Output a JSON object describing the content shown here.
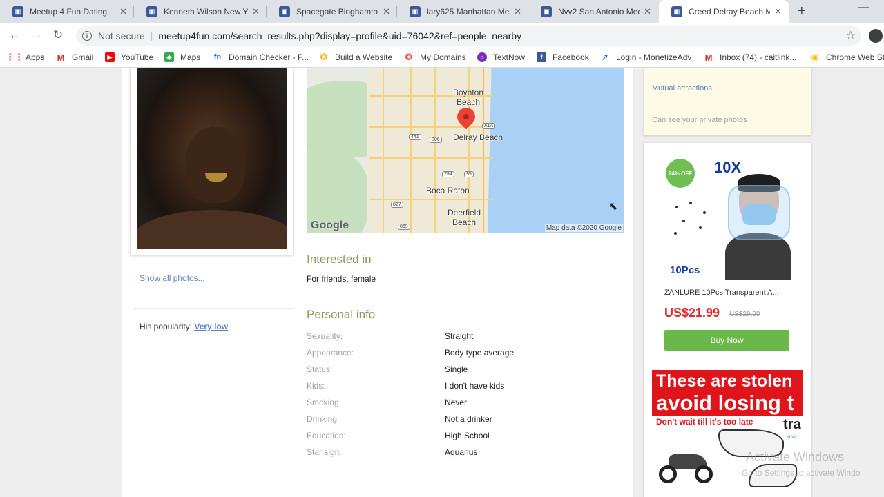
{
  "browser": {
    "tabs": [
      {
        "title": "Meetup 4 Fun Dating",
        "active": false
      },
      {
        "title": "Kenneth Wilson New Y",
        "active": false
      },
      {
        "title": "Spacegate Binghamton",
        "active": false
      },
      {
        "title": "lary625 Manhattan Me",
        "active": false
      },
      {
        "title": "Nvv2 San Antonio Mee",
        "active": false
      },
      {
        "title": "Creed Delray Beach Me",
        "active": true
      }
    ],
    "security_label": "Not secure",
    "url": "meetup4fun.com/search_results.php?display=profile&uid=76042&ref=people_nearby",
    "bookmarks": [
      {
        "label": "Apps",
        "icon": "apps-grid-icon",
        "color": "#e94235"
      },
      {
        "label": "Gmail",
        "icon": "gmail-icon",
        "color": "#d93025"
      },
      {
        "label": "YouTube",
        "icon": "youtube-icon",
        "color": "#ff0000"
      },
      {
        "label": "Maps",
        "icon": "maps-icon",
        "color": "#34a853"
      },
      {
        "label": "Domain Checker - F...",
        "icon": "domain-icon",
        "color": "#1a73e8"
      },
      {
        "label": "Build a Website",
        "icon": "build-icon",
        "color": "#f9ab00"
      },
      {
        "label": "My Domains",
        "icon": "domains-icon",
        "color": "#ea4335"
      },
      {
        "label": "TextNow",
        "icon": "textnow-icon",
        "color": "#7b2cbf"
      },
      {
        "label": "Facebook",
        "icon": "facebook-icon",
        "color": "#3b5998"
      },
      {
        "label": "Login - MonetizeAdv",
        "icon": "login-icon",
        "color": "#1565c0"
      },
      {
        "label": "Inbox (74) - caitlink...",
        "icon": "inbox-icon",
        "color": "#d93025"
      },
      {
        "label": "Chrome Web St",
        "icon": "chrome-icon",
        "color": "#fbbc04"
      }
    ]
  },
  "profile": {
    "show_all_photos": "Show all photos...",
    "popularity_label": "His popularity:",
    "popularity_value": "Very low"
  },
  "map": {
    "labels": {
      "boynton": "Boynton\nBeach",
      "delray": "Delray Beach",
      "boca": "Boca Raton",
      "deerfield": "Deerfield\nBeach"
    },
    "shields": [
      "441",
      "806",
      "A1A",
      "794",
      "95",
      "827",
      "869"
    ],
    "logo": "Google",
    "attribution": "Map data ©2020 Google"
  },
  "interested": {
    "title": "Interested in",
    "value": "For friends, female"
  },
  "personal": {
    "title": "Personal info",
    "rows": [
      {
        "key": "Sexuality:",
        "value": "Straight"
      },
      {
        "key": "Appearance:",
        "value": "Body type average"
      },
      {
        "key": "Status:",
        "value": "Single"
      },
      {
        "key": "Kids:",
        "value": "I don't have kids"
      },
      {
        "key": "Smoking:",
        "value": "Never"
      },
      {
        "key": "Drinking:",
        "value": "Not a drinker"
      },
      {
        "key": "Education:",
        "value": "High School"
      },
      {
        "key": "Star sign:",
        "value": "Aquarius"
      }
    ]
  },
  "sidebar": {
    "mutual": "Mutual attractions",
    "private_photos": "Can see your private photos"
  },
  "ad": {
    "badge": "24% OFF",
    "headline": "10X",
    "pcs": "10Pcs",
    "title": "ZANLURE 10Pcs Transparent A...",
    "price": "US$21.99",
    "old_price": "US$29.00",
    "buy": "Buy Now"
  },
  "ad2": {
    "line1": "These are stolen",
    "line2": "avoid losing t",
    "line3": "Don't wait till it's too late",
    "brand": "tra",
    "brand_sub": "alw"
  },
  "watermark": {
    "line1": "Activate Windows",
    "line2": "Go to Settings to activate Windo"
  }
}
